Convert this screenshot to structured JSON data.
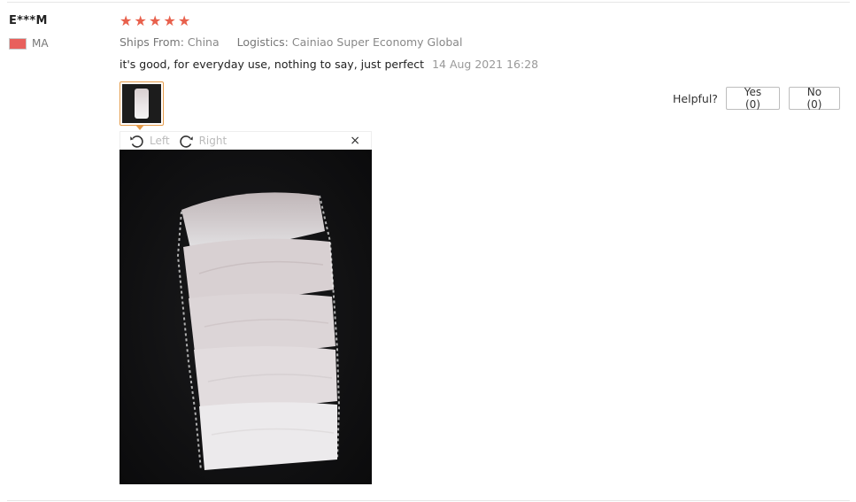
{
  "review": {
    "user": "E***M",
    "country_code": "MA",
    "rating": 5,
    "ships_from_label": "Ships From:",
    "ships_from_value": "China",
    "logistics_label": "Logistics:",
    "logistics_value": "Cainiao Super Economy Global",
    "text": "it's good, for everyday use, nothing to say, just perfect",
    "date": "14 Aug 2021 16:28"
  },
  "helpful": {
    "label": "Helpful?",
    "yes_label": "Yes (0)",
    "no_label": "No (0)"
  },
  "viewer": {
    "rotate_left_label": "Left",
    "rotate_right_label": "Right",
    "close_glyph": "×"
  },
  "colors": {
    "star": "#e8604c",
    "thumb_border": "#e59b4a",
    "flag": "#e8605c"
  },
  "icons": {
    "star": "star-icon",
    "rotate_left": "rotate-left-icon",
    "rotate_right": "rotate-right-icon",
    "close": "close-icon",
    "flag": "flag-icon"
  }
}
